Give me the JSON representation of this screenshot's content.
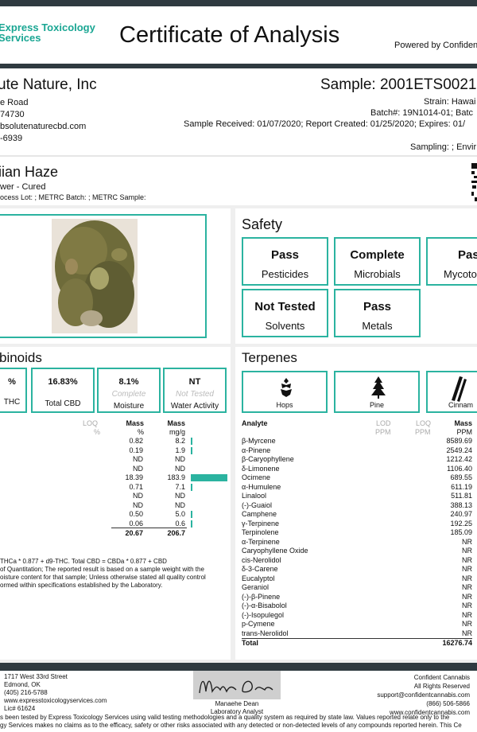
{
  "header": {
    "lab_name_line1": "Express Toxicology",
    "lab_name_line2": "Services",
    "title": "Certificate of Analysis",
    "powered_by": "Powered by Confiden"
  },
  "client": {
    "name": "ute Nature, Inc",
    "address1": "e Road",
    "address2": "74730",
    "email": "bsolutenaturecbd.com",
    "phone": "-6939"
  },
  "sample": {
    "id": "Sample: 2001ETS0021.(",
    "strain": "Strain: Hawai",
    "batch": "Batch#: 19N1014-01; Batc",
    "dates": "Sample Received: 01/07/2020; Report Created: 01/25/2020; Expires: 01/",
    "sampling": "Sampling: ; Envir"
  },
  "product": {
    "name": "iian Haze",
    "type": "wer - Cured",
    "lots": "ocess Lot: ; METRC Batch: ; METRC Sample:"
  },
  "safety": {
    "heading": "Safety",
    "tests": [
      {
        "status": "Pass",
        "label": "Pesticides"
      },
      {
        "status": "Complete",
        "label": "Microbials"
      },
      {
        "status": "Pass",
        "label": "Mycotox"
      },
      {
        "status": "Not Tested",
        "label": "Solvents"
      },
      {
        "status": "Pass",
        "label": "Metals"
      }
    ]
  },
  "cannabinoids": {
    "heading": "binoids",
    "summary": [
      {
        "value": "%",
        "placeholder": "",
        "label": "THC"
      },
      {
        "value": "16.83%",
        "placeholder": "",
        "label": "Total CBD"
      },
      {
        "value": "8.1%",
        "placeholder": "Complete",
        "label": "Moisture"
      },
      {
        "value": "NT",
        "placeholder": "Not Tested",
        "label": "Water Activity"
      }
    ],
    "col_headers": {
      "loq": "LOQ",
      "mass1": "Mass",
      "mass2": "Mass"
    },
    "col_units": {
      "loq": "%",
      "mass1": "%",
      "mass2": "mg/g"
    },
    "rows": [
      {
        "mass_pct": "0.82",
        "mass_mg": "8.2",
        "bar": 0.045
      },
      {
        "mass_pct": "0.19",
        "mass_mg": "1.9",
        "bar": 0.01
      },
      {
        "mass_pct": "ND",
        "mass_mg": "ND",
        "bar": 0
      },
      {
        "mass_pct": "ND",
        "mass_mg": "ND",
        "bar": 0
      },
      {
        "mass_pct": "18.39",
        "mass_mg": "183.9",
        "bar": 1.0
      },
      {
        "mass_pct": "0.71",
        "mass_mg": "7.1",
        "bar": 0.04
      },
      {
        "mass_pct": "ND",
        "mass_mg": "ND",
        "bar": 0
      },
      {
        "mass_pct": "ND",
        "mass_mg": "ND",
        "bar": 0
      },
      {
        "mass_pct": "0.50",
        "mass_mg": "5.0",
        "bar": 0.03
      },
      {
        "mass_pct": "0.06",
        "mass_mg": "0.6",
        "bar": 0.005
      }
    ],
    "total_pct": "20.67",
    "total_mg": "206.7",
    "notes": [
      "THCa * 0.877 + d9-THC. Total CBD = CBDa * 0.877 + CBD",
      "of Quantitation; The reported result is based on a sample weight with the",
      "oisture content for that sample; Unless otherwise stated all quality control",
      "ormed within specifications established by the Laboratory."
    ]
  },
  "terpenes": {
    "heading": "Terpenes",
    "badges": [
      {
        "icon": "hops-icon",
        "label": "Hops"
      },
      {
        "icon": "pine-icon",
        "label": "Pine"
      },
      {
        "icon": "cinnamon-icon",
        "label": "Cinnam"
      }
    ],
    "col_headers": {
      "analyte": "Analyte",
      "lod": "LOD",
      "loq": "LOQ",
      "mass": "Mass"
    },
    "col_units": {
      "lod": "PPM",
      "loq": "PPM",
      "mass": "PPM"
    },
    "rows": [
      {
        "name": "β-Myrcene",
        "ppm": "8589.69"
      },
      {
        "name": "α-Pinene",
        "ppm": "2549.24"
      },
      {
        "name": "β-Caryophyllene",
        "ppm": "1212.42"
      },
      {
        "name": "δ-Limonene",
        "ppm": "1106.40"
      },
      {
        "name": "Ocimene",
        "ppm": "689.55"
      },
      {
        "name": "α-Humulene",
        "ppm": "611.19"
      },
      {
        "name": "Linalool",
        "ppm": "511.81"
      },
      {
        "name": "(-)-Guaiol",
        "ppm": "388.13"
      },
      {
        "name": "Camphene",
        "ppm": "240.97"
      },
      {
        "name": "γ-Terpinene",
        "ppm": "192.25"
      },
      {
        "name": "Terpinolene",
        "ppm": "185.09"
      },
      {
        "name": "α-Terpinene",
        "ppm": "NR"
      },
      {
        "name": "Caryophyllene Oxide",
        "ppm": "NR"
      },
      {
        "name": "cis-Nerolidol",
        "ppm": "NR"
      },
      {
        "name": "δ-3-Carene",
        "ppm": "NR"
      },
      {
        "name": "Eucalyptol",
        "ppm": "NR"
      },
      {
        "name": "Geraniol",
        "ppm": "NR"
      },
      {
        "name": "(-)-β-Pinene",
        "ppm": "NR"
      },
      {
        "name": "(-)-α-Bisabolol",
        "ppm": "NR"
      },
      {
        "name": "(-)-Isopulegol",
        "ppm": "NR"
      },
      {
        "name": "p-Cymene",
        "ppm": "NR"
      },
      {
        "name": "trans-Nerolidol",
        "ppm": "NR"
      }
    ],
    "total_label": "Total",
    "total_ppm": "16276.74"
  },
  "footer": {
    "lab_address1": "1717 West 33rd Street",
    "lab_address2": "Edmond, OK",
    "lab_phone": "(405) 216-5788",
    "lab_web": "www.expresstoxicologyservices.com",
    "lab_lic": "Lic# 61624",
    "signer_name": "Manaehe Dean",
    "signer_title": "Laboratory Analyst",
    "right1": "Confident Cannabis",
    "right2": "All Rights Reserved",
    "right3": "support@confidentcannabis.com",
    "right4": "(866) 506-5866",
    "right5": "www.confidentcannabis.com",
    "disclaimer1": "s been tested by Express Toxicology Services using valid testing methodologies and a quality system as required by state law. Values reported relate only to the",
    "disclaimer2": "gy Services makes no claims as to the efficacy, safety or other risks associated with any detected or non-detected levels of any compounds reported herein. This Ce"
  },
  "colors": {
    "accent": "#2bb3a0",
    "dark_bar": "#2f3a40",
    "brand_teal": "#1aa693"
  }
}
